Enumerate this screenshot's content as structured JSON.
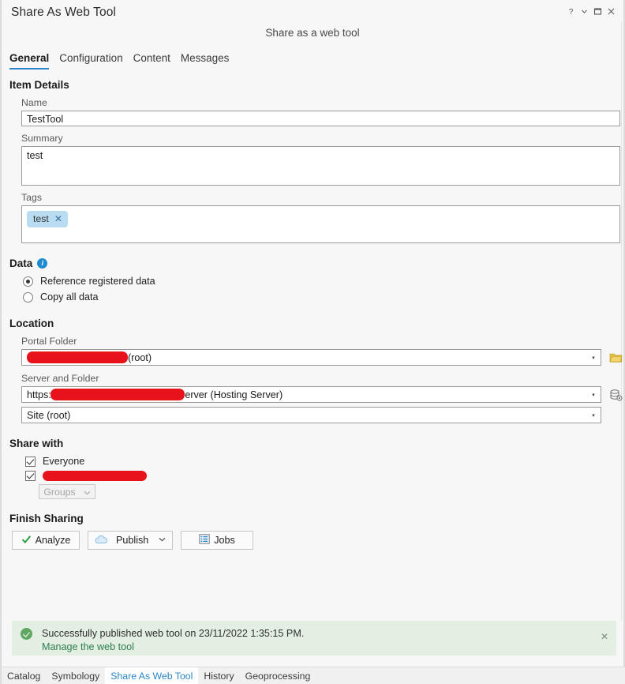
{
  "window": {
    "title": "Share As Web Tool",
    "controls": [
      {
        "name": "help-icon",
        "glyph": "?"
      },
      {
        "name": "chevron-down-icon",
        "glyph": "⌄"
      },
      {
        "name": "maximize-icon",
        "glyph": "□"
      },
      {
        "name": "close-icon",
        "glyph": "✕"
      }
    ]
  },
  "header": {
    "subtitle": "Share as a web tool"
  },
  "tabs": [
    {
      "label": "General",
      "active": true
    },
    {
      "label": "Configuration",
      "active": false
    },
    {
      "label": "Content",
      "active": false
    },
    {
      "label": "Messages",
      "active": false
    }
  ],
  "item_details": {
    "heading": "Item Details",
    "name_label": "Name",
    "name_value": "TestTool",
    "summary_label": "Summary",
    "summary_value": "test",
    "tags_label": "Tags",
    "tags": [
      "test"
    ],
    "tag_remove_glyph": "✕"
  },
  "data_section": {
    "heading": "Data",
    "info_icon": "info-icon",
    "info_glyph": "i",
    "options": [
      {
        "label": "Reference registered data",
        "selected": true
      },
      {
        "label": "Copy all data",
        "selected": false
      }
    ]
  },
  "location": {
    "heading": "Location",
    "portal_folder_label": "Portal Folder",
    "portal_folder_value": "(root)",
    "portal_folder_redacted": true,
    "portal_folder_icon": "folder-icon",
    "server_folder_label": "Server and Folder",
    "server_prefix": "https:/",
    "server_suffix": "erver (Hosting Server)",
    "server_redacted": true,
    "server_icon": "server-settings-icon",
    "site_value": "Site (root)",
    "caret_glyph": "▾"
  },
  "share_with": {
    "heading": "Share with",
    "items": [
      {
        "label": "Everyone",
        "checked": true,
        "redacted": false
      },
      {
        "label": "",
        "checked": true,
        "redacted": true
      }
    ],
    "groups_label": "Groups",
    "groups_caret": "⌄",
    "groups_disabled": true
  },
  "finish_sharing": {
    "heading": "Finish Sharing",
    "buttons": [
      {
        "label": "Analyze",
        "icon": "checkmark-icon"
      },
      {
        "label": "Publish",
        "icon": "cloud-icon",
        "has_caret": true,
        "caret": "▾"
      },
      {
        "label": "Jobs",
        "icon": "list-icon"
      }
    ]
  },
  "message": {
    "icon": "success-icon",
    "text": "Successfully published web tool on 23/11/2022 1:35:15 PM.",
    "link": "Manage the web tool",
    "close_glyph": "✕"
  },
  "dock_tabs": [
    {
      "label": "Catalog",
      "active": false
    },
    {
      "label": "Symbology",
      "active": false
    },
    {
      "label": "Share As Web Tool",
      "active": true
    },
    {
      "label": "History",
      "active": false
    },
    {
      "label": "Geoprocessing",
      "active": false
    }
  ],
  "colors": {
    "accent": "#2b85c7",
    "redaction": "#e8121a",
    "success_bg": "#e2efe2",
    "success_icon": "#5fa863",
    "tag_bg": "#b9dcf2",
    "folder_icon": "#e8c34a"
  }
}
